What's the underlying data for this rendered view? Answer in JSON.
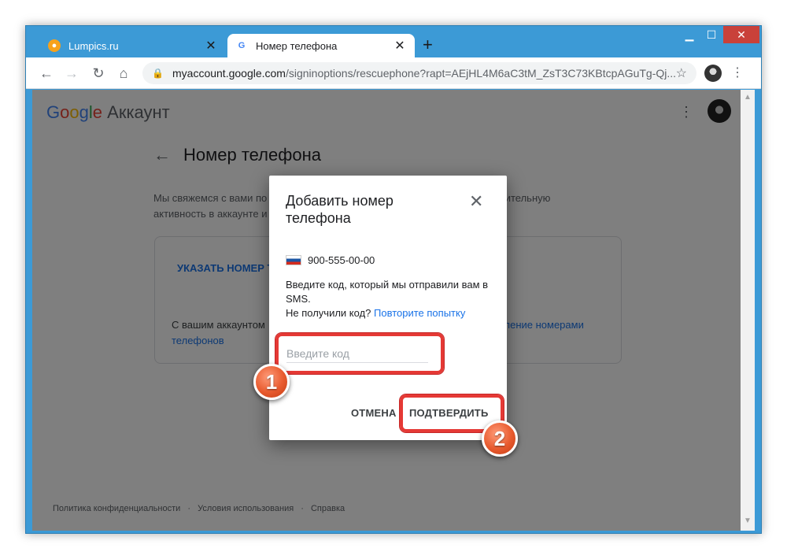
{
  "browser": {
    "tabs": [
      {
        "title": "Lumpics.ru",
        "favicon": "lumpics-orange-icon"
      },
      {
        "title": "Номер телефона",
        "favicon": "google-g-icon"
      }
    ],
    "new_tab": "+",
    "url_host": "myaccount.google.com",
    "url_path": "/signinoptions/rescuephone?rapt=AEjHL4M6aC3tM_ZsT3C73KBtcpAGuTg-Qj...",
    "window_controls": {
      "minimize": "▁",
      "maximize": "☐",
      "close": "✕"
    }
  },
  "page": {
    "header": {
      "brand_letters": [
        "G",
        "o",
        "o",
        "g",
        "l",
        "e"
      ],
      "brand_suffix": "Аккаунт"
    },
    "title": "Номер телефона",
    "description_line1": "Мы свяжемся с вами по",
    "description_line1b": "одозрительную",
    "description_line2": "активность в аккаунте и",
    "card": {
      "add_link": "УКАЗАТЬ НОМЕР Т",
      "text_start": "С вашим аккаунтом",
      "text_link_end": "ление номерами",
      "text_link_line2": "телефонов"
    },
    "footer": [
      "Политика конфиденциальности",
      "·",
      "Условия использования",
      "·",
      "Справка"
    ]
  },
  "dialog": {
    "title": "Добавить номер телефона",
    "phone": "900-555-00-00",
    "instruction": "Введите код, который мы отправили вам в SMS.",
    "no_code": "Не получили код?",
    "retry_link": "Повторите попытку",
    "code_placeholder": "Введите код",
    "cancel": "ОТМЕНА",
    "confirm": "ПОДТВЕРДИТЬ"
  },
  "annotations": {
    "step1": "1",
    "step2": "2",
    "highlight_color": "#e53935",
    "badge_color": "#e85a2e"
  }
}
